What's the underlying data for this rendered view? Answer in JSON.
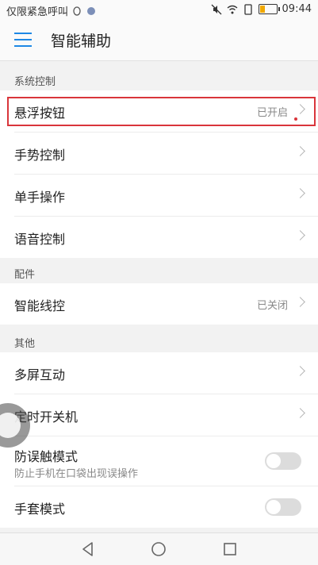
{
  "status_bar": {
    "carrier_text": "仅限紧急呼叫",
    "time": "09:44",
    "icons": [
      "qq-icon",
      "app-icon",
      "mute-icon",
      "wifi-icon",
      "sim-icon",
      "battery-icon"
    ]
  },
  "header": {
    "title": "智能辅助"
  },
  "sections": [
    {
      "title": "系统控制",
      "items": [
        {
          "label": "悬浮按钮",
          "value": "已开启"
        },
        {
          "label": "手势控制"
        },
        {
          "label": "单手操作"
        },
        {
          "label": "语音控制"
        }
      ]
    },
    {
      "title": "配件",
      "items": [
        {
          "label": "智能线控",
          "value": "已关闭"
        }
      ]
    },
    {
      "title": "其他",
      "items": [
        {
          "label": "多屏互动"
        },
        {
          "label": "定时开关机"
        },
        {
          "label": "防误触模式",
          "subtitle": "防止手机在口袋出现误操作",
          "toggle": false
        },
        {
          "label": "手套模式",
          "toggle": false
        }
      ]
    }
  ],
  "colors": {
    "accent": "#1e88e5",
    "highlight": "#d9353b"
  }
}
